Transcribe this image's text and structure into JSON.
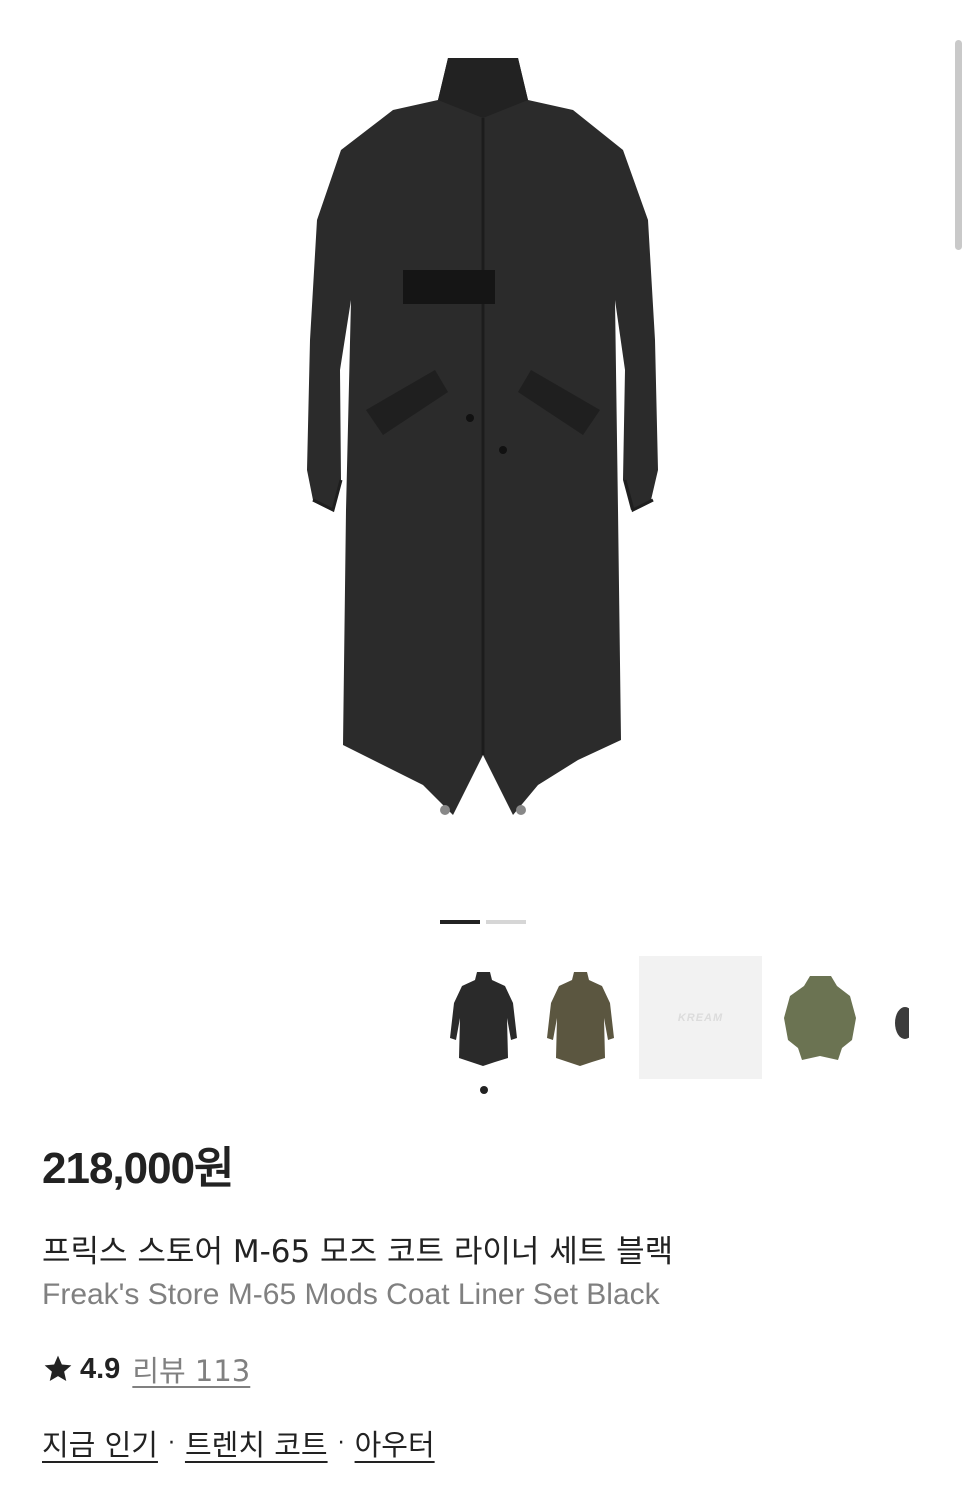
{
  "product": {
    "price": "218,000원",
    "name_ko": "프릭스 스토어 M-65 모즈 코트 라이너 세트 블랙",
    "name_en": "Freak's Store M-65 Mods Coat Liner Set Black",
    "rating": "4.9",
    "review_label": "리뷰 113",
    "image_index": 1,
    "image_count": 2
  },
  "thumbnails": [
    {
      "name": "black-coat",
      "color": "#2a2a2a"
    },
    {
      "name": "olive-coat",
      "color": "#5b5640"
    },
    {
      "name": "kream-placeholder",
      "logo_text": "KREAM"
    },
    {
      "name": "green-coat",
      "color": "#6b7352"
    }
  ],
  "tags": [
    "지금 인기",
    "트렌치 코트",
    "아우터"
  ],
  "tag_separator": "·",
  "colors": {
    "text": "#222222",
    "muted": "#808080",
    "coat": "#2b2b2b"
  }
}
